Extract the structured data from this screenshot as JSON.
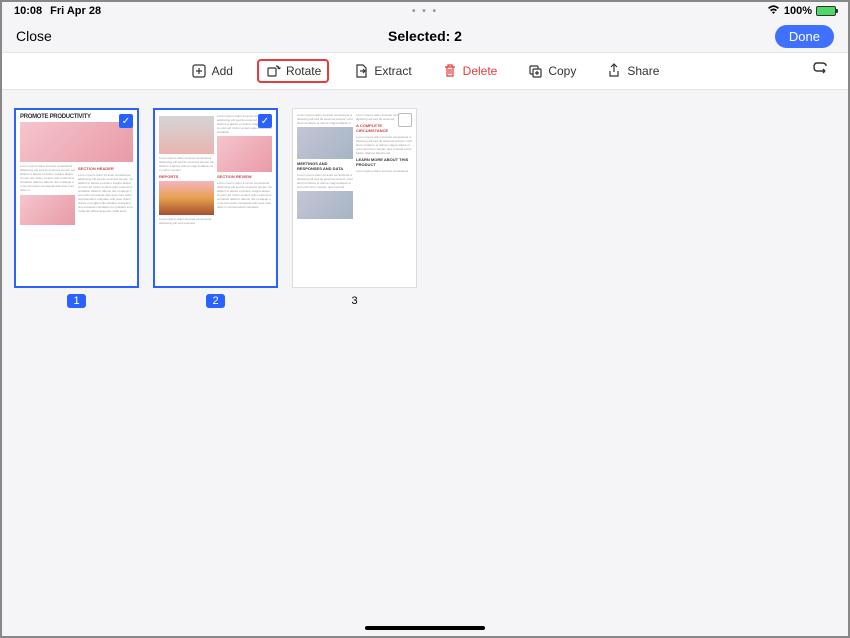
{
  "status": {
    "time": "10:08",
    "date": "Fri Apr 28",
    "battery": "100%",
    "center_dots": "• • •"
  },
  "header": {
    "close": "Close",
    "title": "Selected: 2",
    "done": "Done"
  },
  "toolbar": {
    "add": "Add",
    "rotate": "Rotate",
    "extract": "Extract",
    "delete": "Delete",
    "copy": "Copy",
    "share": "Share"
  },
  "pages": [
    {
      "label": "1",
      "selected": true,
      "title": "PROMOTE PRODUCTIVITY"
    },
    {
      "label": "2",
      "selected": true,
      "title": ""
    },
    {
      "label": "3",
      "selected": false,
      "title": ""
    }
  ]
}
